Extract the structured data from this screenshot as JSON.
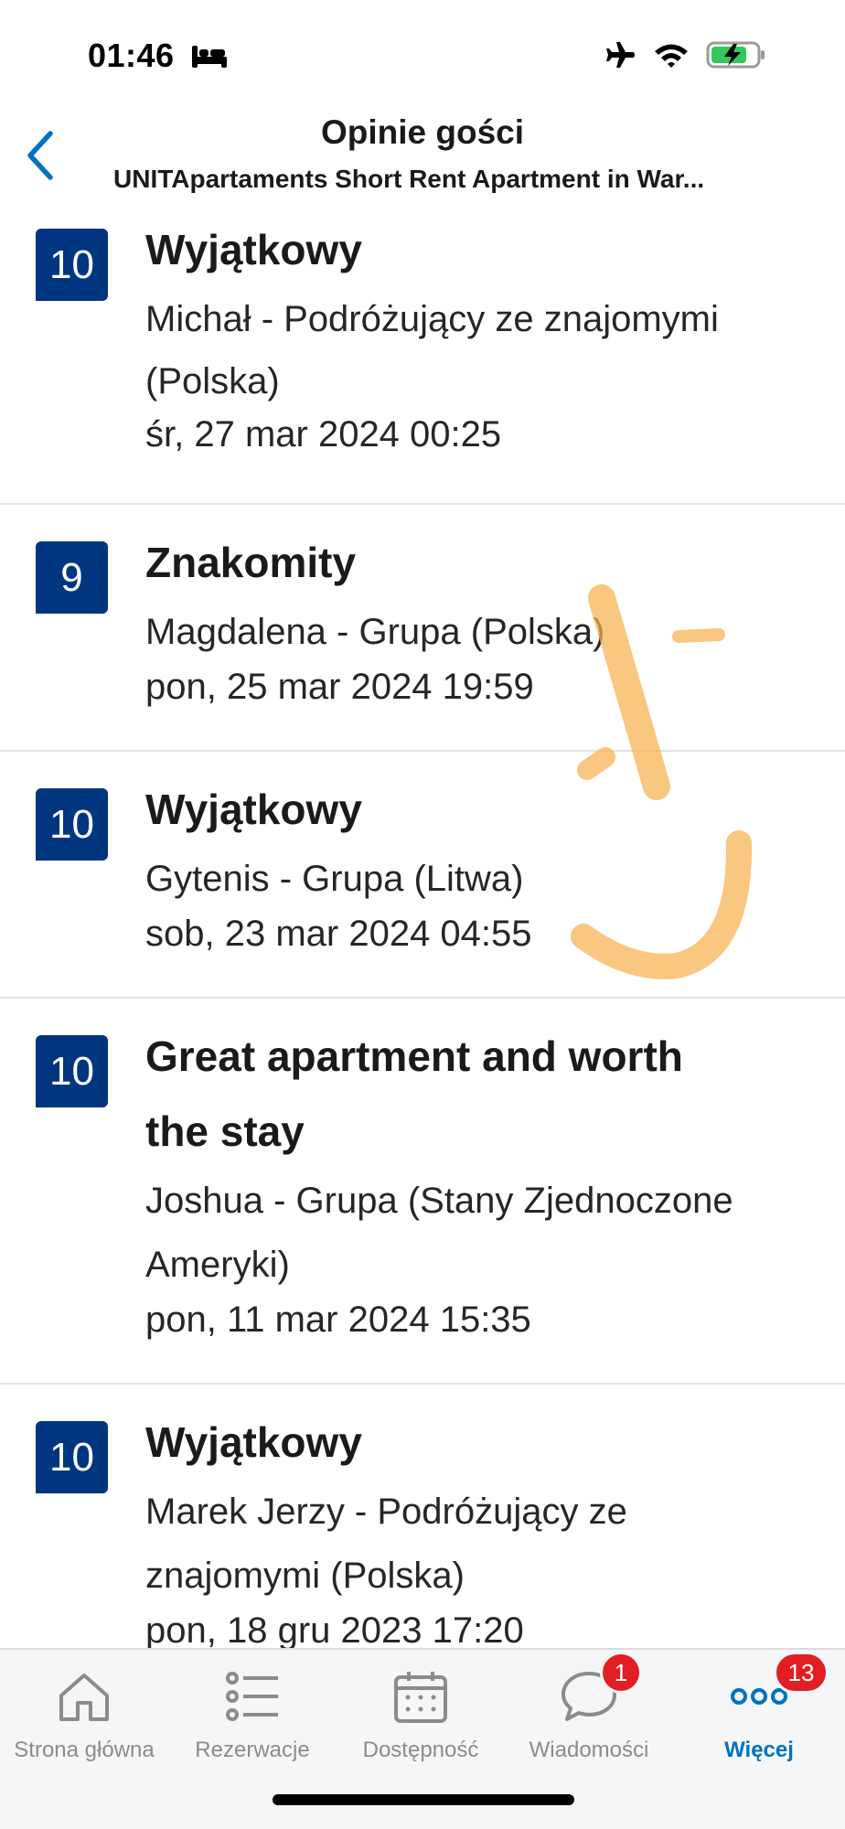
{
  "status_bar": {
    "time": "01:46"
  },
  "header": {
    "title": "Opinie gości",
    "subtitle": "UNITApartaments Short Rent Apartment in War..."
  },
  "reviews": [
    {
      "score": "10",
      "title": "Wyjątkowy",
      "author_line1": "Michał - Podróżujący ze znajomymi",
      "author_line2": "(Polska)",
      "date": "śr, 27 mar 2024 00:25"
    },
    {
      "score": "9",
      "title": "Znakomity",
      "author_line1": "Magdalena - Grupa (Polska)",
      "author_line2": "",
      "date": "pon, 25 mar 2024 19:59"
    },
    {
      "score": "10",
      "title": "Wyjątkowy",
      "author_line1": "Gytenis - Grupa (Litwa)",
      "author_line2": "",
      "date": "sob, 23 mar 2024 04:55"
    },
    {
      "score": "10",
      "title_line1": "Great apartment and worth",
      "title_line2": "the stay",
      "author_line1": "Joshua - Grupa (Stany Zjednoczone",
      "author_line2": "Ameryki)",
      "date": "pon, 11 mar 2024 15:35"
    },
    {
      "score": "10",
      "title": "Wyjątkowy",
      "author_line1": "Marek Jerzy - Podróżujący ze",
      "author_line2": "znajomymi (Polska)",
      "date": "pon, 18 gru 2023 17:20"
    }
  ],
  "tabs": [
    {
      "label": "Strona główna",
      "icon": "home-icon"
    },
    {
      "label": "Rezerwacje",
      "icon": "list-icon"
    },
    {
      "label": "Dostępność",
      "icon": "calendar-icon"
    },
    {
      "label": "Wiadomości",
      "icon": "chat-icon",
      "badge": "1"
    },
    {
      "label": "Więcej",
      "icon": "more-icon",
      "badge": "13",
      "active": true
    }
  ],
  "colors": {
    "score_badge": "#003580",
    "active_tab": "#0071c2",
    "notification_badge": "#e21e25",
    "highlight": "#f6b14e"
  }
}
